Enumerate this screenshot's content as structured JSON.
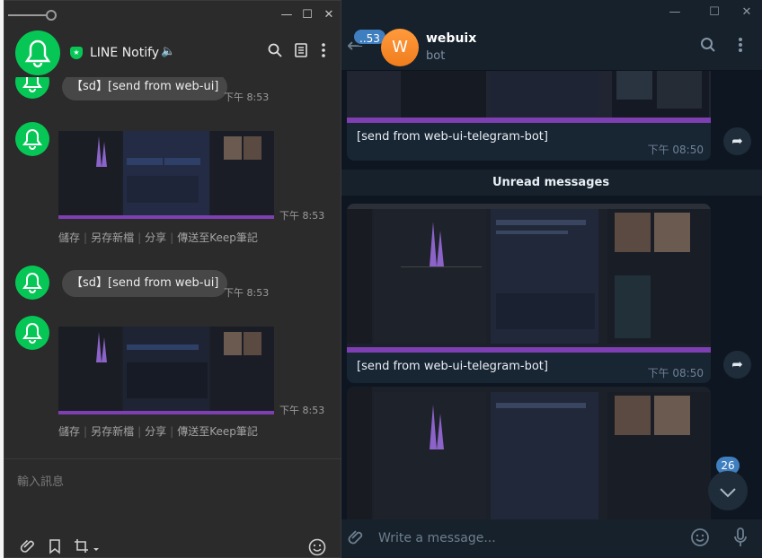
{
  "telegram": {
    "window_controls": [
      "—",
      "☐",
      "✕"
    ],
    "unread_count_badge": "..53",
    "chat": {
      "avatar_letter": "W",
      "name": "webuix",
      "status": "bot"
    },
    "messages": [
      {
        "caption": "[send from web-ui-telegram-bot]",
        "time": "下午 08:50"
      },
      {
        "caption": "[send from web-ui-telegram-bot]",
        "time": "下午 08:50"
      }
    ],
    "unread_divider": "Unread messages",
    "scroll_badge": "26",
    "compose": {
      "placeholder": "Write a message..."
    },
    "colors": {
      "accent": "#3f7fbf",
      "avatar": "#f07d1d",
      "bubble": "#182533",
      "background": "#0e1621"
    }
  },
  "line": {
    "title": "LINE Notify",
    "window_controls": [
      "—",
      "☐",
      "✕"
    ],
    "messages": [
      {
        "text": "【sd】[send from web-ui]",
        "time": "下午 8:53"
      },
      {
        "time": "下午 8:53",
        "actions": [
          "儲存",
          "另存新檔",
          "分享",
          "傳送至Keep筆記"
        ]
      },
      {
        "text": "【sd】[send from web-ui]",
        "time": "下午 8:53"
      },
      {
        "time": "下午 8:53",
        "actions": [
          "儲存",
          "另存新檔",
          "分享",
          "傳送至Keep筆記"
        ]
      }
    ],
    "compose": {
      "placeholder": "輸入訊息"
    },
    "colors": {
      "brand": "#06c755",
      "bubble": "#474747",
      "background": "#2b2b2b"
    }
  }
}
